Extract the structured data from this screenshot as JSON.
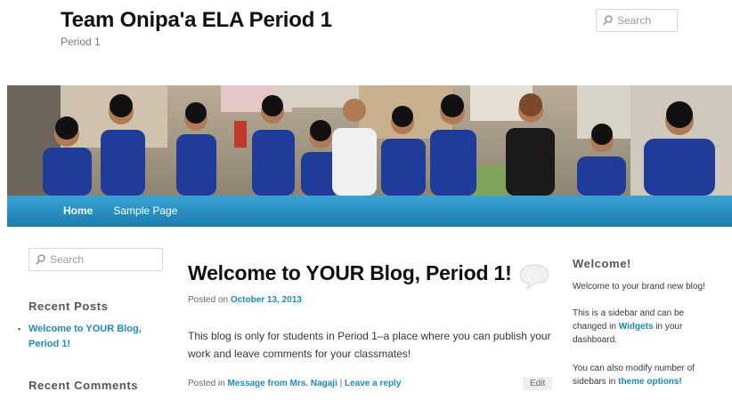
{
  "site": {
    "title": "Team Onipa'a ELA Period 1",
    "description": "Period 1"
  },
  "search": {
    "top_placeholder": "Search",
    "side_placeholder": "Search"
  },
  "nav": {
    "items": [
      {
        "label": "Home"
      },
      {
        "label": "Sample Page"
      }
    ]
  },
  "sidebar_left": {
    "recent_posts_title": "Recent Posts",
    "recent_posts": [
      {
        "label": "Welcome to YOUR Blog, Period 1!"
      }
    ],
    "recent_comments_title": "Recent Comments"
  },
  "post": {
    "title": "Welcome to YOUR Blog, Period 1!",
    "posted_on_prefix": "Posted on ",
    "date": "October 13, 2013",
    "content": "This blog is only for students in Period 1–a place where you can publish your work and leave comments for your classmates!",
    "posted_in_prefix": "Posted in ",
    "category": "Message from Mrs. Nagaji",
    "separator": " | ",
    "reply_link": "Leave a reply",
    "edit_label": "Edit"
  },
  "sidebar_right": {
    "title": "Welcome!",
    "para1": "Welcome to your brand new blog!",
    "para2_prefix": "This is a sidebar and can be changed in ",
    "para2_link": "Widgets",
    "para2_suffix": " in your dashboard.",
    "para3_prefix": "You can also modify number of sidebars in ",
    "para3_link": "theme options!"
  },
  "colors": {
    "link": "#1b8bbe",
    "nav_top": "#3aa3d3",
    "nav_bottom": "#1a7fb1"
  },
  "icons": {
    "search": "search-icon",
    "comment": "comment-bubble-icon"
  }
}
